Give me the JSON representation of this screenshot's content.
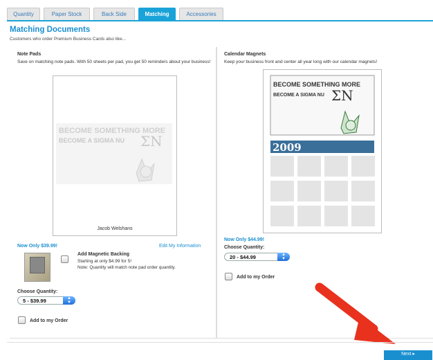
{
  "tabs": [
    {
      "label": "Quantity"
    },
    {
      "label": "Paper Stock"
    },
    {
      "label": "Back Side"
    },
    {
      "label": "Matching"
    },
    {
      "label": "Accessories"
    }
  ],
  "page": {
    "title": "Matching Documents",
    "subtitle": "Customers who order Premium Business Cards also like..."
  },
  "left": {
    "title": "Note Pads",
    "description": "Save on matching note pads. With 50 sheets per pad, you get 50 reminders about your business!",
    "preview_line1": "BECOME SOMETHING MORE",
    "preview_line2": "BECOME A SIGMA NU",
    "preview_letters": "ΣN",
    "preview_name": "Jacob Welshans",
    "price": "Now Only $39.99!",
    "edit_link": "Edit My Information",
    "backing_title": "Add Magnetic Backing",
    "backing_price": "Starting at only $4.99 for 5!",
    "backing_note": "Note: Quantity will match note pad order quantity.",
    "choose_label": "Choose Quantity:",
    "select_value": "5 - $39.99",
    "add_label": "Add to my Order"
  },
  "right": {
    "title": "Calendar Magnets",
    "description": "Keep your business front and center all year long with our calendar magnets!",
    "preview_line1": "BECOME SOMETHING MORE",
    "preview_line2": "BECOME A SIGMA NU",
    "preview_letters": "ΣN",
    "year": "2009",
    "price": "Now Only $44.99!",
    "choose_label": "Choose Quantity:",
    "select_value": "20 - $44.99",
    "add_label": "Add to my Order"
  },
  "footer": {
    "next_label": "Next"
  },
  "colors": {
    "accent": "#1aa3d8",
    "arrow": "#e8321e"
  }
}
